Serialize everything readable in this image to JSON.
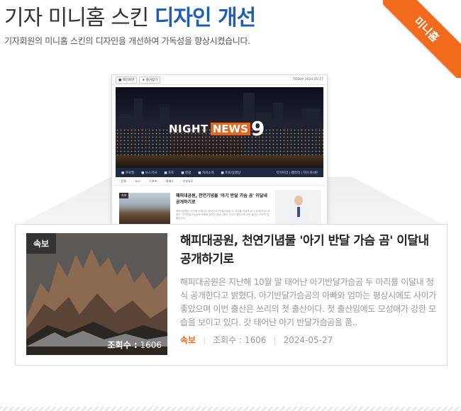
{
  "header": {
    "title_plain": "기자 미니홈 스킨",
    "title_accent": "디자인 개선",
    "subtitle": "기자회원의 미니홈 스킨의 디자인을 개선하여 가독성을 향상시켰습니다."
  },
  "ribbon": {
    "label": "미니홈",
    "color": "#f26a1b"
  },
  "preview": {
    "top_buttons": [
      "■ 메인화면",
      "★ 즐겨찾기"
    ],
    "date": "TODAY 2024-05-27",
    "logo": {
      "part1": "NIGHT",
      "part2": "NEWS",
      "part3": "9"
    },
    "nav_items": [
      "■ 프로필",
      "■ 뉴스기사",
      "■ 포토",
      "■ 칼럼",
      "■ 자서소개",
      "■ 포토/동영상"
    ],
    "nav_right": "다이어리 | 캘러리 | 자유게시판",
    "sub_items": [
      "· 전체",
      "· 뉴스",
      "· 스포츠",
      "· 클래스",
      "· 기부뉴스"
    ],
    "mini_badge": "속보",
    "mini_title": "해피대공원, 천연기념물 '아기 반달 가슴 곰' 이달내 공개하기로",
    "mini_body": "해피대공원은 지난해 10월 말 태어난 아기반달가슴곰 두 마리를 이달내 정식 공개한다고 밝혔다. 아기반달가슴곰의 아빠와 엄마는 평상시에도 사이가 좋았으며 이번 출산은 쓰리의 첫 출산이다."
  },
  "article": {
    "badge": "속보",
    "views_label": "조회수 :",
    "views_value": "1606",
    "headline": "해피대공원, 천연기념물 '아기 반달 가슴 곰' 이달내 공개하기로",
    "summary": "해피대공원은 지난해 10월 말 태어난 아기반달가슴곰 두 마리를 이달내 정식 공개한다고 밝혔다. 아기반달가슴곰의 아빠와 엄마는 평상시에도 사이가 좋았으며 이번 출산은 쓰리의 첫 출산이다. 첫 출산임에도 모성애가 강한 모습을 보이고 있다. 갓 태어난 아기 반달가슴곰을 품..",
    "meta_category": "속보",
    "meta_views": "조회수 : 1606",
    "meta_date": "2024-05-27"
  },
  "colors": {
    "accent_blue": "#1f5eb5",
    "accent_orange": "#f26a1b"
  }
}
